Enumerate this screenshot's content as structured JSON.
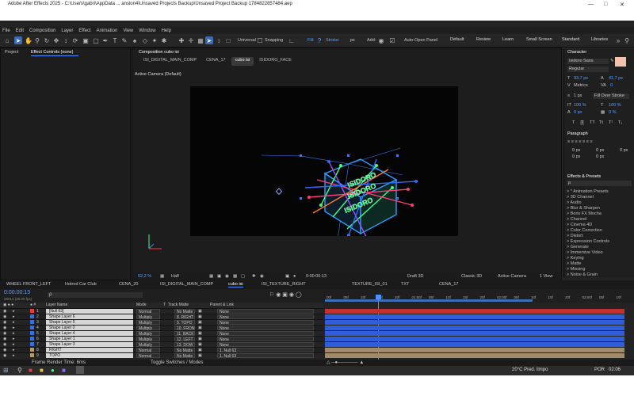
{
  "window": {
    "title": "Adobe After Effects 2025 - C:\\Users\\gabri\\AppData ... ansion4\\Unsaved Projects Backup\\Unsaved Project Backup 1784822857484.aep",
    "min_icon": "minimize-icon",
    "max_icon": "maximize-icon",
    "close_icon": "close-icon"
  },
  "menu": [
    "File",
    "Edit",
    "Composition",
    "Layer",
    "Effect",
    "Animation",
    "View",
    "Window",
    "Help"
  ],
  "toolbar": {
    "universal": "Universal",
    "snapping": "Snapping",
    "fill": "Fill:",
    "stroke": "Stroke:",
    "stroke_unit": "px",
    "add": "Add:",
    "auto_open": "Auto-Open Panel",
    "workspaces": [
      "Default",
      "Review",
      "Learn",
      "Small Screen",
      "Standard",
      "Libraries"
    ]
  },
  "left_panel": {
    "tab1": "Project",
    "tab2": "Effect Controls (none)"
  },
  "composition": {
    "panel_title": "Composition cubo isi",
    "tabs": [
      "ISI_DIGITAL_MAIN_COMP",
      "CENA_17",
      "cubo isi",
      "ISIDORO_FACE"
    ],
    "active_tab": 2,
    "camera_label": "Active Camera (Default)",
    "cube_text": "ISIDORO"
  },
  "viewer_footer": {
    "zoom": "62,2 %",
    "quality": "Half",
    "timecode": "0:00:00:13",
    "draft": "Draft 3D",
    "renderer": "Classic 3D",
    "camera": "Active Camera",
    "views": "1 View"
  },
  "character": {
    "title": "Character",
    "font": "Isidoro Sans",
    "style": "Regular",
    "size": "93,7 px",
    "leading": "41,7 px",
    "tracking_label": "Metrics",
    "tracking": "0",
    "stroke_w": "1 px",
    "stroke_mode": "Fill Over Stroke",
    "vscale": "100 %",
    "hscale": "100 %",
    "baseline": "0 px",
    "tsume": "0 %",
    "type_buttons": [
      "T",
      "T",
      "TT",
      "Tt",
      "T¹",
      "T₁"
    ]
  },
  "paragraph": {
    "title": "Paragraph",
    "indent": [
      "0 px",
      "0 px",
      "0 px",
      "0 px",
      "0 px"
    ]
  },
  "effects": {
    "title": "Effects & Presets",
    "search_placeholder": "ρ",
    "items": [
      "> * Animation Presets",
      "> 3D Channel",
      "> Audio",
      "> Blur & Sharpen",
      "> Boris FX Mocha",
      "> Channel",
      "> Cinema 4D",
      "> Color Correction",
      "> Distort",
      "> Expression Controls",
      "> Generate",
      "> Immersive Video",
      "> Keying",
      "> Matte",
      "> Missing",
      "> Noise & Grain"
    ]
  },
  "timeline_tabs": [
    "WHEEL FRONT_LEFT",
    "Hotrod Car Club",
    "CENA_20",
    "ISI_DIGITAL_MAIN_COMP",
    "cubo isi",
    "ISI_TEXTURE_RIGHT",
    "",
    "TEXTURE_ISI_01",
    "TXT",
    "CENA_17"
  ],
  "timeline_active": 4,
  "timeline": {
    "timecode": "0:00:00:13",
    "fps_info": "00013 (25.00 fps)",
    "search_placeholder": "ρ",
    "headers": {
      "layer": "Layer Name",
      "mode": "Mode",
      "t": "T",
      "trkmat": "Track Matte",
      "parent": "Parent & Link"
    },
    "ruler": [
      "00f",
      "05f",
      "10f",
      "15f",
      "20f",
      "01:00f",
      "05f",
      "10f",
      "15f",
      "20f",
      "02:00f",
      "05f",
      "10f",
      "15f",
      "20f",
      "03:00f",
      "05f",
      "10f"
    ],
    "status": "Frame Render Time: 6ms",
    "toggle": "Toggle Switches / Modes"
  },
  "layers": [
    {
      "num": "1",
      "name": "[Null 63]",
      "mode": "Normal",
      "matte": "No Matte",
      "parent": "None",
      "color": "#e04040",
      "bar": "#c33030"
    },
    {
      "num": "2",
      "name": "Shape Layer 6",
      "mode": "Multiply",
      "matte": "8. RIGHT",
      "parent": "None",
      "color": "#3b6fd4",
      "bar": "#2f5ed8"
    },
    {
      "num": "3",
      "name": "Shape Layer 5",
      "mode": "Multiply",
      "matte": "9. TOPO",
      "parent": "None",
      "color": "#3b6fd4",
      "bar": "#2f5ed8"
    },
    {
      "num": "4",
      "name": "Shape Layer 2",
      "mode": "Multiply",
      "matte": "10. FRON",
      "parent": "None",
      "color": "#3b6fd4",
      "bar": "#2f5ed8"
    },
    {
      "num": "5",
      "name": "Shape Layer 4",
      "mode": "Multiply",
      "matte": "11. BACK",
      "parent": "None",
      "color": "#3b6fd4",
      "bar": "#2f5ed8"
    },
    {
      "num": "6",
      "name": "Shape Layer 1",
      "mode": "Multiply",
      "matte": "12. LEFT",
      "parent": "None",
      "color": "#3b6fd4",
      "bar": "#2f5ed8"
    },
    {
      "num": "7",
      "name": "Shape Layer 3",
      "mode": "Multiply",
      "matte": "13. DOW",
      "parent": "None",
      "color": "#3b6fd4",
      "bar": "#2f5ed8"
    },
    {
      "num": "8",
      "name": "RIGHT",
      "mode": "Normal",
      "matte": "No Matte",
      "parent": "1. Null 63",
      "color": "#b59a6a",
      "bar": "#a08a6a"
    },
    {
      "num": "9",
      "name": "TOPO",
      "mode": "Normal",
      "matte": "No Matte",
      "parent": "1. Null 63",
      "color": "#b59a6a",
      "bar": "#a08a6a"
    }
  ],
  "taskbar": {
    "weather": "20°C Pred. limpo",
    "lang": "POR",
    "clock": "02:06"
  }
}
